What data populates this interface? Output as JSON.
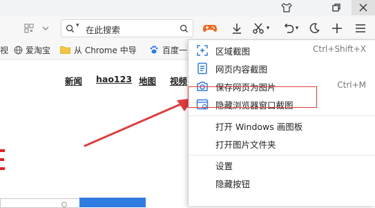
{
  "toolbar": {
    "search_placeholder": "在此搜索"
  },
  "bookmarks": {
    "item1_prefix": "视",
    "item2": "爱淘宝",
    "item3": "从 Chrome 中导",
    "item4": "百度一"
  },
  "page": {
    "nav": [
      "新闻",
      "hao123",
      "地图",
      "视频"
    ]
  },
  "menu": {
    "items": [
      {
        "label": "区域截图",
        "shortcut": "Ctrl+Shift+X"
      },
      {
        "label": "网页内容截图",
        "shortcut": ""
      },
      {
        "label": "保存网页为图片",
        "shortcut": "Ctrl+M"
      },
      {
        "label": "隐藏浏览器窗口截图",
        "shortcut": ""
      },
      {
        "label": "打开 Windows 画图板",
        "shortcut": ""
      },
      {
        "label": "打开图片文件夹",
        "shortcut": ""
      },
      {
        "label": "设置",
        "shortcut": ""
      },
      {
        "label": "隐藏按钮",
        "shortcut": ""
      }
    ]
  },
  "colors": {
    "accent_blue": "#2f7de1",
    "highlight_red": "#e23b3b",
    "game_orange": "#f26b1d",
    "search_button_blue": "#2f7de1"
  }
}
